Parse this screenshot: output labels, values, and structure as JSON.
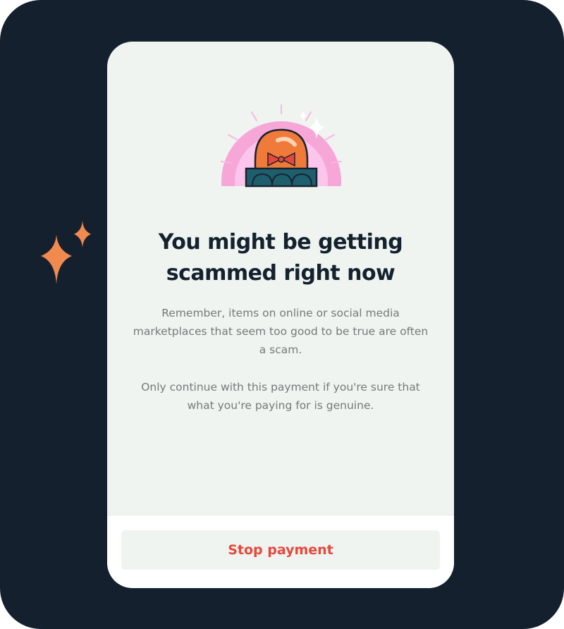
{
  "dialog": {
    "title_line1": "You might be getting",
    "title_line2": "scammed right now",
    "body_paragraph_1": "Remember, items on online or social media marketplaces that seem too good to be true are often a scam.",
    "body_paragraph_2": "Only continue with this payment if you're sure that what you're paying for is genuine.",
    "stop_button_label": "Stop payment"
  },
  "icons": {
    "illustration": "alarm-siren-icon",
    "decoration": "sparkle-icon"
  },
  "colors": {
    "background": "#15202e",
    "card": "#eff4f0",
    "title": "#14212e",
    "body_text": "#76797b",
    "accent_red": "#e8473b",
    "sparkle_orange": "#f08a4f",
    "siren_halo": "#f7a6d8"
  }
}
